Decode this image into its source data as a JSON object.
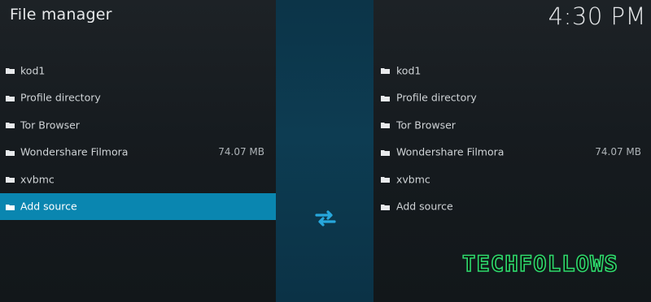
{
  "header": {
    "title": "File manager",
    "clock": "4:30 PM"
  },
  "left_pane": {
    "items": [
      {
        "label": "kod1",
        "size": "",
        "icon": "folder-icon",
        "selected": false
      },
      {
        "label": "Profile directory",
        "size": "",
        "icon": "folder-icon",
        "selected": false
      },
      {
        "label": "Tor Browser",
        "size": "",
        "icon": "folder-icon",
        "selected": false
      },
      {
        "label": "Wondershare Filmora",
        "size": "74.07 MB",
        "icon": "folder-icon",
        "selected": false
      },
      {
        "label": "xvbmc",
        "size": "",
        "icon": "folder-icon",
        "selected": false
      },
      {
        "label": "Add source",
        "size": "",
        "icon": "folder-icon",
        "selected": true
      }
    ]
  },
  "right_pane": {
    "items": [
      {
        "label": "kod1",
        "size": "",
        "icon": "folder-icon"
      },
      {
        "label": "Profile directory",
        "size": "",
        "icon": "folder-icon"
      },
      {
        "label": "Tor Browser",
        "size": "",
        "icon": "folder-icon"
      },
      {
        "label": "Wondershare Filmora",
        "size": "74.07 MB",
        "icon": "folder-icon"
      },
      {
        "label": "xvbmc",
        "size": "",
        "icon": "folder-icon"
      },
      {
        "label": "Add source",
        "size": "",
        "icon": "folder-icon"
      }
    ]
  },
  "swap": {
    "icon": "swap-arrows-icon"
  },
  "watermark": {
    "text": "TECHFOLLOWS"
  },
  "colors": {
    "accent": "#0a86b0",
    "center_strip": "#0d3c52",
    "swap_icon": "#27a7dc",
    "watermark_fill": "#0a0f0c",
    "watermark_outline": "#2ed86c"
  }
}
